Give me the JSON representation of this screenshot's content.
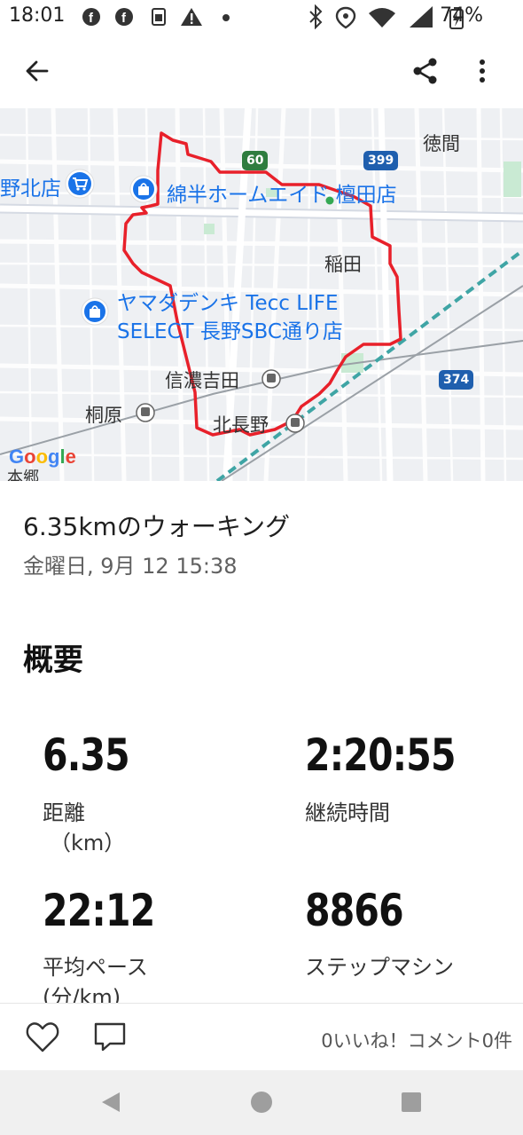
{
  "status_bar": {
    "time": "18:01",
    "battery": "74%",
    "left_icons": [
      "facebook-icon",
      "facebook-icon",
      "sim-icon",
      "warning-icon",
      "dot-icon"
    ],
    "right_icons": [
      "bluetooth-icon",
      "location-icon",
      "wifi-icon",
      "signal-icon",
      "battery-charging-icon"
    ]
  },
  "app_bar": {
    "back_icon": "arrow-back-icon",
    "share_icon": "share-icon",
    "more_icon": "more-vert-icon"
  },
  "map": {
    "pois": [
      {
        "name": "綿半ホームエイド 檀田店",
        "icon": "shopping-bag-icon"
      },
      {
        "name_line1": "ヤマダデンキ Tecc LIFE",
        "name_line2": "SELECT 長野SBC通り店",
        "icon": "shopping-bag-icon"
      },
      {
        "name": "野北店",
        "icon": "shopping-cart-icon"
      }
    ],
    "places": [
      "徳間",
      "稲田"
    ],
    "stations": [
      "信濃吉田",
      "桐原",
      "北長野"
    ],
    "road_shields": [
      "60",
      "399",
      "374"
    ],
    "bottom_fragment": "本郷",
    "google_logo": "Google",
    "route_color": "#e8202a"
  },
  "activity": {
    "title": "6.35kmのウォーキング",
    "datetime": "金曜日, 9月 12 15:38"
  },
  "overview": {
    "heading": "概要",
    "stats": [
      {
        "value": "6.35",
        "label": "距離",
        "unit": "（km）"
      },
      {
        "value": "2:20:55",
        "label": "継続時間",
        "unit": ""
      },
      {
        "value": "22:12",
        "label": "平均ペース",
        "unit": "(分/km)"
      },
      {
        "value": "8866",
        "label": "ステップマシン",
        "unit": ""
      }
    ]
  },
  "social": {
    "likes_comments": "0いいね！コメント0件",
    "like_icon": "heart-outline-icon",
    "comment_icon": "comment-icon"
  },
  "navigation": {
    "back": "nav-back-icon",
    "home": "nav-home-icon",
    "recents": "nav-recents-icon"
  }
}
